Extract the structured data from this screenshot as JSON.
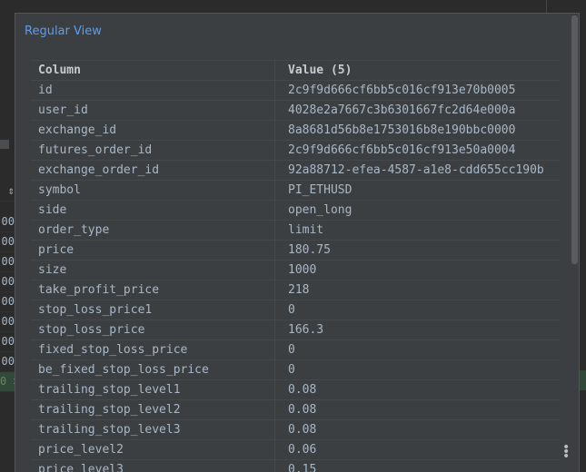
{
  "background_editor": {
    "left_rows": [
      {
        "text": "⇕"
      },
      {
        "text": "00"
      },
      {
        "text": "00"
      },
      {
        "text": "00"
      },
      {
        "text": "00"
      },
      {
        "text": "00"
      },
      {
        "text": "00"
      },
      {
        "text": "00"
      },
      {
        "text": "00"
      },
      {
        "text": "0 >"
      }
    ]
  },
  "popup": {
    "header_label": "Regular View",
    "columns": {
      "column_header": "Column",
      "value_header": "Value (5)"
    },
    "rows": [
      {
        "column": "id",
        "value": "2c9f9d666cf6bb5c016cf913e70b0005"
      },
      {
        "column": "user_id",
        "value": "4028e2a7667c3b6301667fc2d64e000a"
      },
      {
        "column": "exchange_id",
        "value": "8a8681d56b8e1753016b8e190bbc0000"
      },
      {
        "column": "futures_order_id",
        "value": "2c9f9d666cf6bb5c016cf913e50a0004"
      },
      {
        "column": "exchange_order_id",
        "value": "92a88712-efea-4587-a1e8-cdd655cc190b"
      },
      {
        "column": "symbol",
        "value": "PI_ETHUSD"
      },
      {
        "column": "side",
        "value": "open_long"
      },
      {
        "column": "order_type",
        "value": "limit"
      },
      {
        "column": "price",
        "value": "180.75"
      },
      {
        "column": "size",
        "value": "1000"
      },
      {
        "column": "take_profit_price",
        "value": "218"
      },
      {
        "column": "stop_loss_price1",
        "value": "0"
      },
      {
        "column": "stop_loss_price",
        "value": "166.3"
      },
      {
        "column": "fixed_stop_loss_price",
        "value": "0"
      },
      {
        "column": "be_fixed_stop_loss_price",
        "value": "0"
      },
      {
        "column": "trailing_stop_level1",
        "value": "0.08"
      },
      {
        "column": "trailing_stop_level2",
        "value": "0.08"
      },
      {
        "column": "trailing_stop_level3",
        "value": "0.08"
      },
      {
        "column": "price_level2",
        "value": "0.06"
      },
      {
        "column": "price_level3",
        "value": "0.15"
      }
    ],
    "more_icon": "more-vertical-icon"
  },
  "colors": {
    "link_blue": "#589df6",
    "popup_bg": "#3c3f41",
    "text": "#a9b7c6"
  }
}
